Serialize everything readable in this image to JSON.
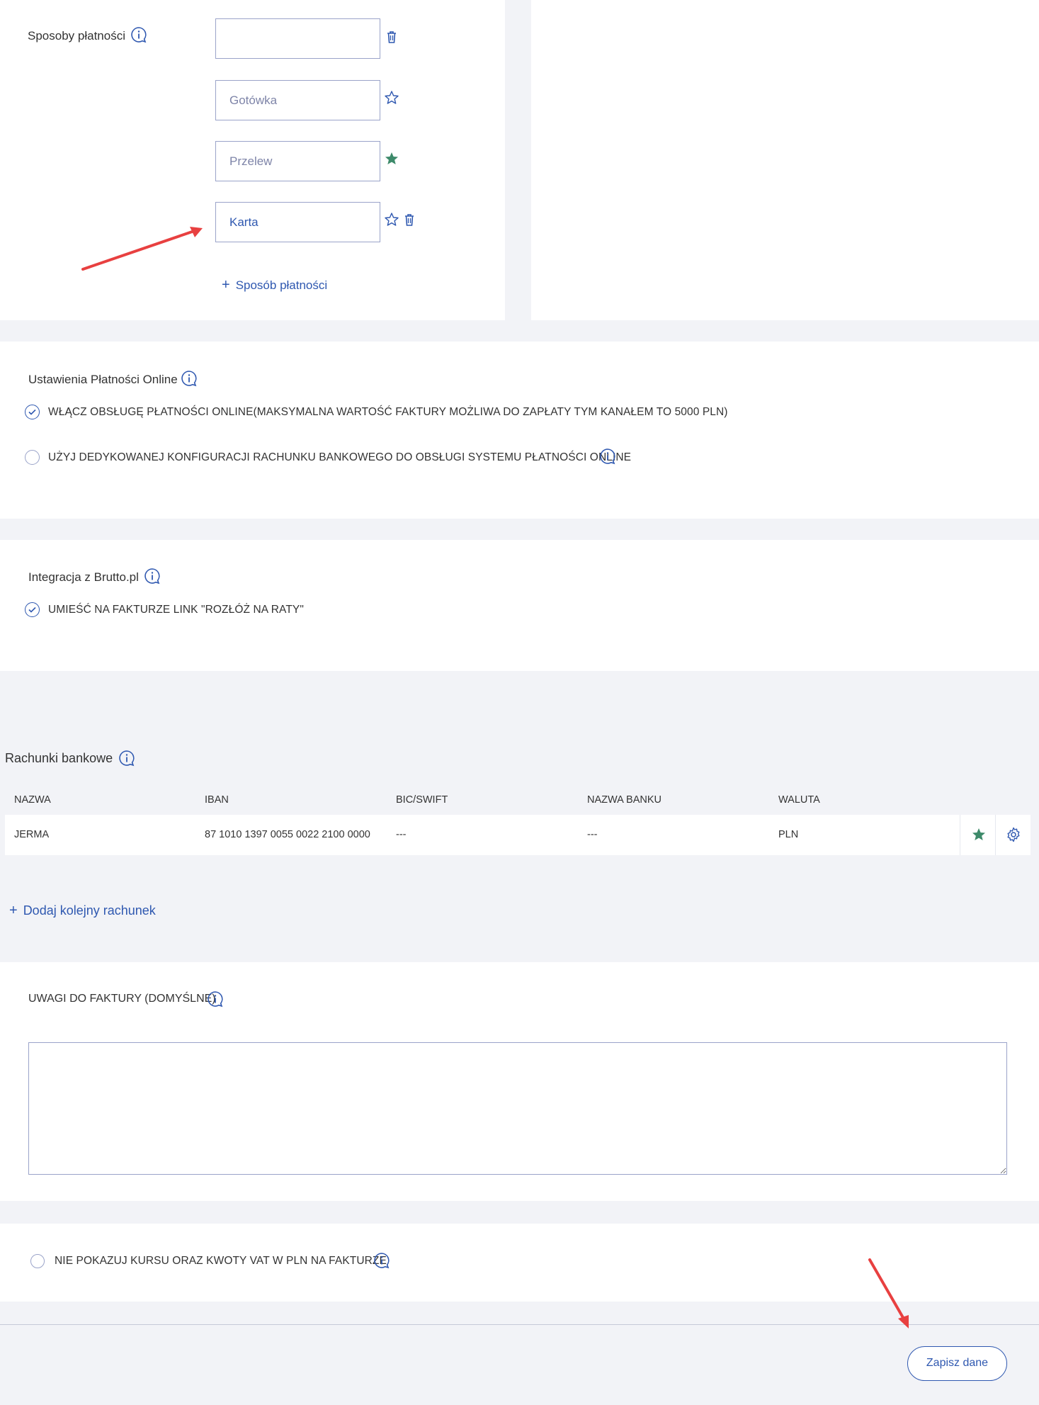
{
  "colors": {
    "accent": "#2f58b0",
    "star_filled": "#3d8a6a",
    "arrow": "#e84040",
    "background": "#f2f3f7"
  },
  "payment_methods": {
    "label": "Sposoby płatności",
    "items": [
      {
        "value": "",
        "icons": [
          "trash-icon"
        ]
      },
      {
        "value": "Gotówka",
        "icons": [
          "star-outline-icon"
        ]
      },
      {
        "value": "Przelew",
        "icons": [
          "star-filled-icon"
        ]
      },
      {
        "value": "Karta",
        "icons": [
          "star-outline-icon",
          "trash-icon"
        ]
      }
    ],
    "add_label": "Sposób płatności"
  },
  "online_payments": {
    "title": "Ustawienia Płatności Online",
    "options": [
      {
        "label": "WŁĄCZ OBSŁUGĘ PŁATNOŚCI ONLINE(MAKSYMALNA WARTOŚĆ FAKTURY MOŻLIWA DO ZAPŁATY TYM KANAŁEM TO 5000 PLN)",
        "checked": true
      },
      {
        "label": "UŻYJ DEDYKOWANEJ KONFIGURACJI RACHUNKU BANKOWEGO DO OBSŁUGI SYSTEMU PŁATNOŚCI ONLINE",
        "checked": false
      }
    ]
  },
  "brutto": {
    "title": "Integracja z Brutto.pl",
    "option": {
      "label": "UMIEŚĆ NA FAKTURZE LINK \"ROZŁÓŻ NA RATY\"",
      "checked": true
    }
  },
  "bank_accounts": {
    "title": "Rachunki bankowe",
    "columns": [
      "NAZWA",
      "IBAN",
      "BIC/SWIFT",
      "NAZWA BANKU",
      "WALUTA"
    ],
    "rows": [
      {
        "name": "JERMA",
        "iban": "87 1010 1397 0055 0022 2100 0000",
        "bic": "---",
        "bank": "---",
        "currency": "PLN"
      }
    ],
    "add_label": "Dodaj kolejny rachunek"
  },
  "invoice_notes": {
    "title": "UWAGI DO FAKTURY (DOMYŚLNE)",
    "value": ""
  },
  "vat_option": {
    "label": "NIE POKAZUJ KURSU ORAZ KWOTY VAT W PLN NA FAKTURZE",
    "checked": false
  },
  "save_label": "Zapisz dane"
}
